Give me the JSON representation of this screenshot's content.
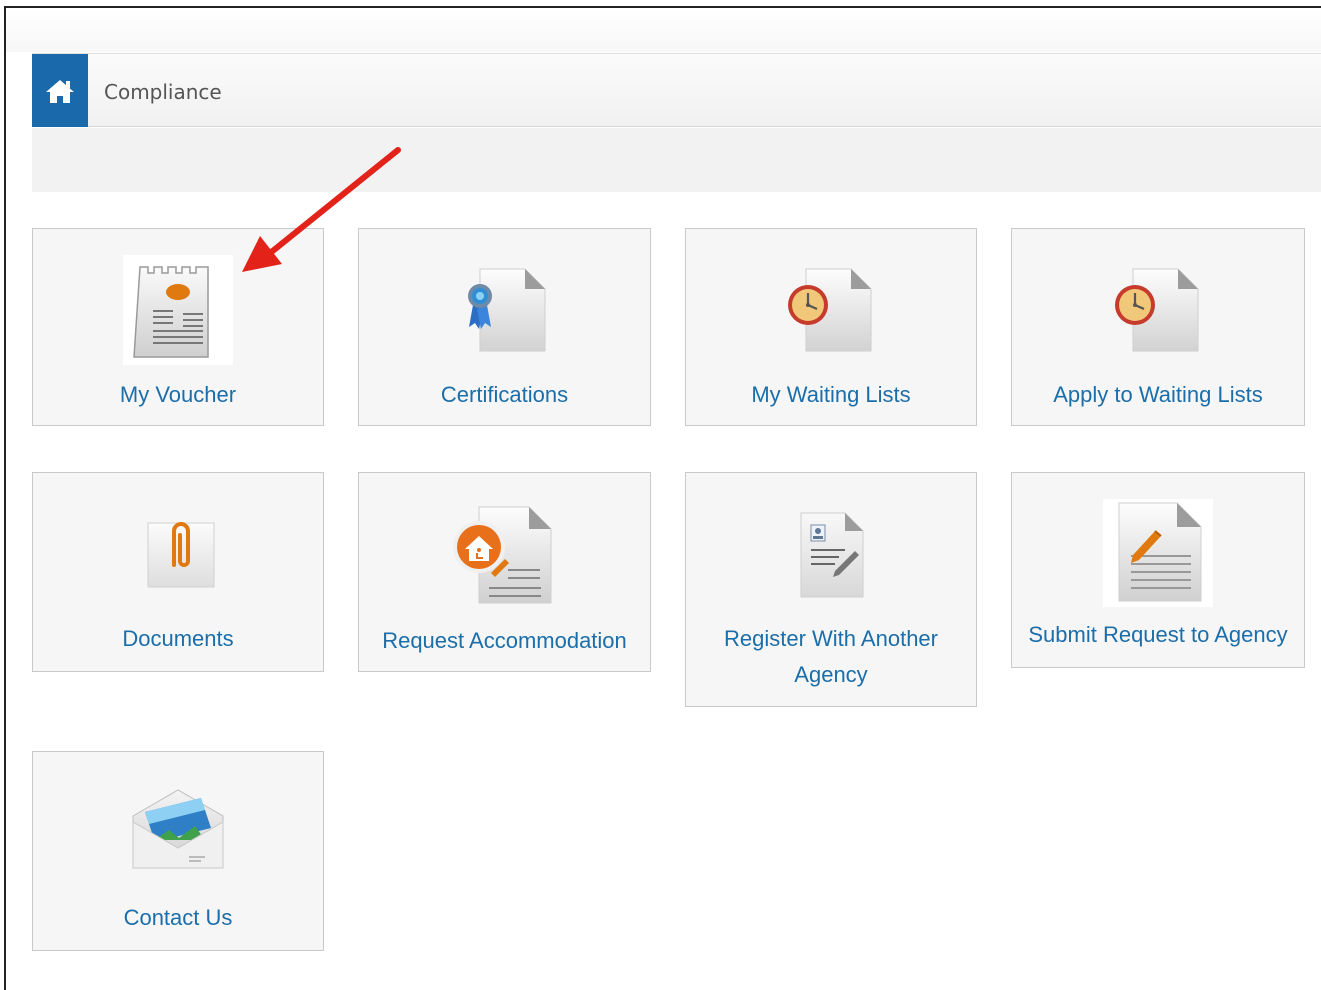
{
  "breadcrumb": {
    "home_icon": "home-icon",
    "current": "Compliance"
  },
  "tiles": [
    {
      "label": "My Voucher",
      "icon": "voucher-icon"
    },
    {
      "label": "Certifications",
      "icon": "certificate-ribbon-icon"
    },
    {
      "label": "My Waiting Lists",
      "icon": "clock-document-icon"
    },
    {
      "label": "Apply to Waiting Lists",
      "icon": "clock-document-icon"
    },
    {
      "label": "Documents",
      "icon": "paperclip-icon"
    },
    {
      "label": "Request Accommodation",
      "icon": "accessibility-document-icon"
    },
    {
      "label": "Register With Another Agency",
      "icon": "registration-form-icon"
    },
    {
      "label": "Submit Request to Agency",
      "icon": "edit-document-icon"
    },
    {
      "label": "Contact Us",
      "icon": "envelope-icon"
    }
  ],
  "annotation": {
    "type": "arrow",
    "color": "#e32219",
    "points_to": "My Voucher"
  },
  "colors": {
    "accent": "#1a6aab",
    "link": "#1b6ea9"
  }
}
